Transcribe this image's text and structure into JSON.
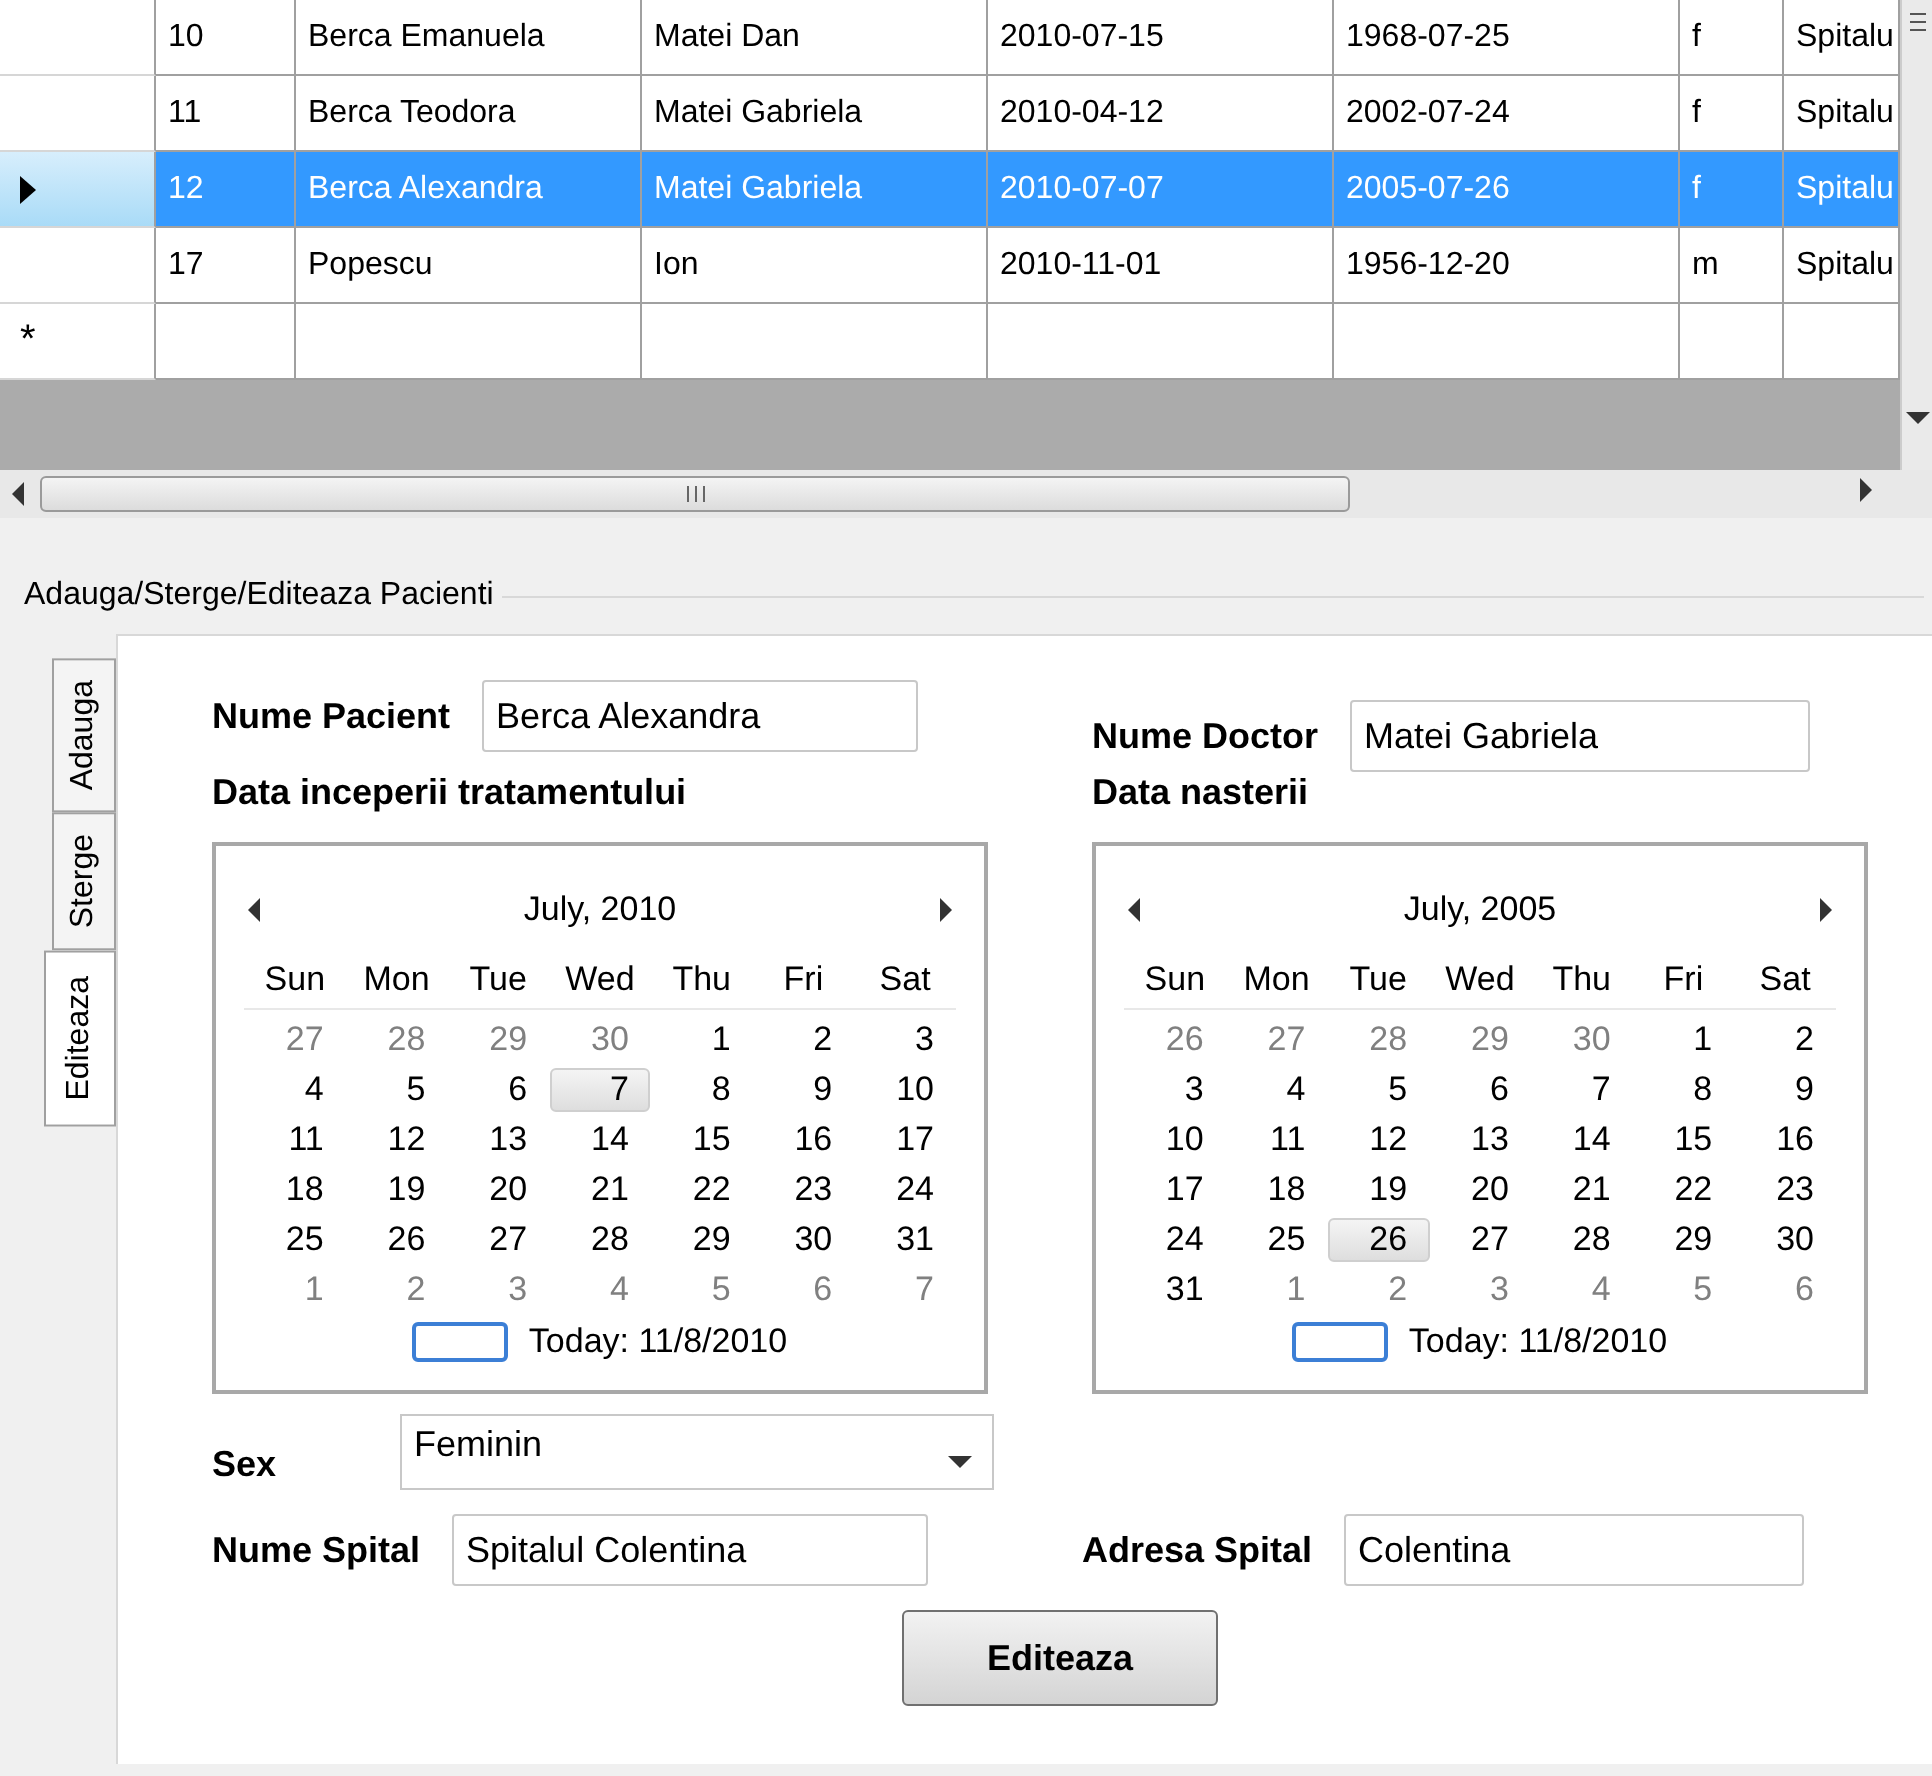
{
  "grid": {
    "rows": [
      {
        "selected": false,
        "cells": [
          "10",
          "Berca Emanuela",
          "Matei Dan",
          "2010-07-15",
          "1968-07-25",
          "f",
          "Spitalu"
        ]
      },
      {
        "selected": false,
        "cells": [
          "11",
          "Berca Teodora",
          "Matei Gabriela",
          "2010-04-12",
          "2002-07-24",
          "f",
          "Spitalu"
        ]
      },
      {
        "selected": true,
        "cells": [
          "12",
          "Berca Alexandra",
          "Matei Gabriela",
          "2010-07-07",
          "2005-07-26",
          "f",
          "Spitalu"
        ]
      },
      {
        "selected": false,
        "cells": [
          "17",
          "Popescu",
          "Ion",
          "2010-11-01",
          "1956-12-20",
          "m",
          "Spitalu"
        ]
      }
    ],
    "new_row_marker": "*"
  },
  "group_title": "Adauga/Sterge/Editeaza Pacienti",
  "tabs": [
    {
      "label": "Adauga",
      "selected": false
    },
    {
      "label": "Sterge",
      "selected": false
    },
    {
      "label": "Editeaza",
      "selected": true
    }
  ],
  "form": {
    "patient_label": "Nume Pacient",
    "patient_value": "Berca Alexandra",
    "doctor_label": "Nume Doctor",
    "doctor_value": "Matei Gabriela",
    "calendars": [
      {
        "label": "Data inceperii tratamentului",
        "title": "July, 2010",
        "weekdays": [
          "Sun",
          "Mon",
          "Tue",
          "Wed",
          "Thu",
          "Fri",
          "Sat"
        ],
        "today": "Today: 11/8/2010",
        "weeks": [
          [
            {
              "day": "27",
              "muted": true,
              "selected": false
            },
            {
              "day": "28",
              "muted": true,
              "selected": false
            },
            {
              "day": "29",
              "muted": true,
              "selected": false
            },
            {
              "day": "30",
              "muted": true,
              "selected": false
            },
            {
              "day": "1",
              "muted": false,
              "selected": false
            },
            {
              "day": "2",
              "muted": false,
              "selected": false
            },
            {
              "day": "3",
              "muted": false,
              "selected": false
            }
          ],
          [
            {
              "day": "4",
              "muted": false,
              "selected": false
            },
            {
              "day": "5",
              "muted": false,
              "selected": false
            },
            {
              "day": "6",
              "muted": false,
              "selected": false
            },
            {
              "day": "7",
              "muted": false,
              "selected": true
            },
            {
              "day": "8",
              "muted": false,
              "selected": false
            },
            {
              "day": "9",
              "muted": false,
              "selected": false
            },
            {
              "day": "10",
              "muted": false,
              "selected": false
            }
          ],
          [
            {
              "day": "11",
              "muted": false,
              "selected": false
            },
            {
              "day": "12",
              "muted": false,
              "selected": false
            },
            {
              "day": "13",
              "muted": false,
              "selected": false
            },
            {
              "day": "14",
              "muted": false,
              "selected": false
            },
            {
              "day": "15",
              "muted": false,
              "selected": false
            },
            {
              "day": "16",
              "muted": false,
              "selected": false
            },
            {
              "day": "17",
              "muted": false,
              "selected": false
            }
          ],
          [
            {
              "day": "18",
              "muted": false,
              "selected": false
            },
            {
              "day": "19",
              "muted": false,
              "selected": false
            },
            {
              "day": "20",
              "muted": false,
              "selected": false
            },
            {
              "day": "21",
              "muted": false,
              "selected": false
            },
            {
              "day": "22",
              "muted": false,
              "selected": false
            },
            {
              "day": "23",
              "muted": false,
              "selected": false
            },
            {
              "day": "24",
              "muted": false,
              "selected": false
            }
          ],
          [
            {
              "day": "25",
              "muted": false,
              "selected": false
            },
            {
              "day": "26",
              "muted": false,
              "selected": false
            },
            {
              "day": "27",
              "muted": false,
              "selected": false
            },
            {
              "day": "28",
              "muted": false,
              "selected": false
            },
            {
              "day": "29",
              "muted": false,
              "selected": false
            },
            {
              "day": "30",
              "muted": false,
              "selected": false
            },
            {
              "day": "31",
              "muted": false,
              "selected": false
            }
          ],
          [
            {
              "day": "1",
              "muted": true,
              "selected": false
            },
            {
              "day": "2",
              "muted": true,
              "selected": false
            },
            {
              "day": "3",
              "muted": true,
              "selected": false
            },
            {
              "day": "4",
              "muted": true,
              "selected": false
            },
            {
              "day": "5",
              "muted": true,
              "selected": false
            },
            {
              "day": "6",
              "muted": true,
              "selected": false
            },
            {
              "day": "7",
              "muted": true,
              "selected": false
            }
          ]
        ]
      },
      {
        "label": "Data nasterii",
        "title": "July, 2005",
        "weekdays": [
          "Sun",
          "Mon",
          "Tue",
          "Wed",
          "Thu",
          "Fri",
          "Sat"
        ],
        "today": "Today: 11/8/2010",
        "weeks": [
          [
            {
              "day": "26",
              "muted": true,
              "selected": false
            },
            {
              "day": "27",
              "muted": true,
              "selected": false
            },
            {
              "day": "28",
              "muted": true,
              "selected": false
            },
            {
              "day": "29",
              "muted": true,
              "selected": false
            },
            {
              "day": "30",
              "muted": true,
              "selected": false
            },
            {
              "day": "1",
              "muted": false,
              "selected": false
            },
            {
              "day": "2",
              "muted": false,
              "selected": false
            }
          ],
          [
            {
              "day": "3",
              "muted": false,
              "selected": false
            },
            {
              "day": "4",
              "muted": false,
              "selected": false
            },
            {
              "day": "5",
              "muted": false,
              "selected": false
            },
            {
              "day": "6",
              "muted": false,
              "selected": false
            },
            {
              "day": "7",
              "muted": false,
              "selected": false
            },
            {
              "day": "8",
              "muted": false,
              "selected": false
            },
            {
              "day": "9",
              "muted": false,
              "selected": false
            }
          ],
          [
            {
              "day": "10",
              "muted": false,
              "selected": false
            },
            {
              "day": "11",
              "muted": false,
              "selected": false
            },
            {
              "day": "12",
              "muted": false,
              "selected": false
            },
            {
              "day": "13",
              "muted": false,
              "selected": false
            },
            {
              "day": "14",
              "muted": false,
              "selected": false
            },
            {
              "day": "15",
              "muted": false,
              "selected": false
            },
            {
              "day": "16",
              "muted": false,
              "selected": false
            }
          ],
          [
            {
              "day": "17",
              "muted": false,
              "selected": false
            },
            {
              "day": "18",
              "muted": false,
              "selected": false
            },
            {
              "day": "19",
              "muted": false,
              "selected": false
            },
            {
              "day": "20",
              "muted": false,
              "selected": false
            },
            {
              "day": "21",
              "muted": false,
              "selected": false
            },
            {
              "day": "22",
              "muted": false,
              "selected": false
            },
            {
              "day": "23",
              "muted": false,
              "selected": false
            }
          ],
          [
            {
              "day": "24",
              "muted": false,
              "selected": false
            },
            {
              "day": "25",
              "muted": false,
              "selected": false
            },
            {
              "day": "26",
              "muted": false,
              "selected": true
            },
            {
              "day": "27",
              "muted": false,
              "selected": false
            },
            {
              "day": "28",
              "muted": false,
              "selected": false
            },
            {
              "day": "29",
              "muted": false,
              "selected": false
            },
            {
              "day": "30",
              "muted": false,
              "selected": false
            }
          ],
          [
            {
              "day": "31",
              "muted": false,
              "selected": false
            },
            {
              "day": "1",
              "muted": true,
              "selected": false
            },
            {
              "day": "2",
              "muted": true,
              "selected": false
            },
            {
              "day": "3",
              "muted": true,
              "selected": false
            },
            {
              "day": "4",
              "muted": true,
              "selected": false
            },
            {
              "day": "5",
              "muted": true,
              "selected": false
            },
            {
              "day": "6",
              "muted": true,
              "selected": false
            }
          ]
        ]
      }
    ],
    "sex_label": "Sex",
    "sex_value": "Feminin",
    "hospital_label": "Nume Spital",
    "hospital_value": "Spitalul Colentina",
    "address_label": "Adresa Spital",
    "address_value": "Colentina",
    "submit": "Editeaza"
  }
}
